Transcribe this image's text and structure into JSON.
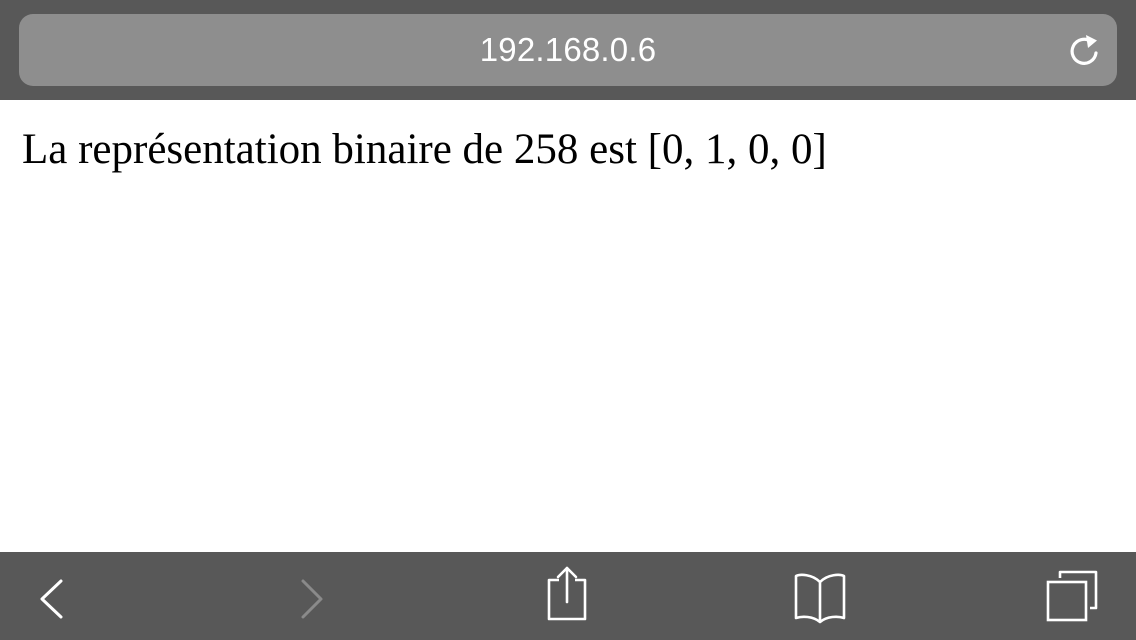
{
  "browser": {
    "address_bar": {
      "url": "192.168.0.6",
      "reload_icon": "reload-icon"
    },
    "toolbar": {
      "items": [
        {
          "name": "back",
          "icon": "chevron-left-icon",
          "enabled": true
        },
        {
          "name": "forward",
          "icon": "chevron-right-icon",
          "enabled": false
        },
        {
          "name": "share",
          "icon": "share-icon",
          "enabled": true
        },
        {
          "name": "bookmarks",
          "icon": "book-icon",
          "enabled": true
        },
        {
          "name": "tabs",
          "icon": "tabs-icon",
          "enabled": true
        }
      ]
    },
    "colors": {
      "chrome": "#585858",
      "address_bar": "#8e8e8e",
      "icon": "#ffffff",
      "icon_disabled": "#8a8a8a"
    }
  },
  "page": {
    "text": "La représentation binaire de 258 est [0, 1, 0, 0]"
  }
}
